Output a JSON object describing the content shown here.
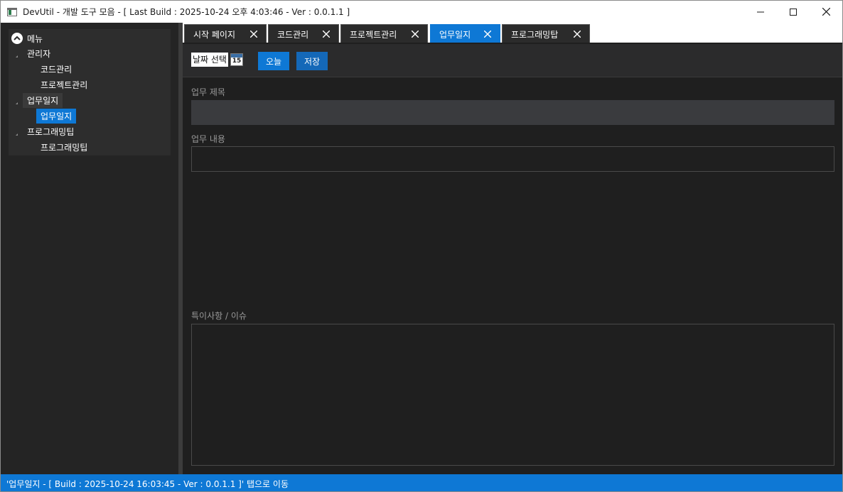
{
  "window": {
    "title": "DevUtil - 개발 도구 모음 - [ Last Build : 2025-10-24 오후 4:03:46 - Ver : 0.0.1.1 ]"
  },
  "sidebar": {
    "root_label": "메뉴",
    "groups": [
      {
        "label": "관리자",
        "children": [
          "코드관리",
          "프로젝트관리"
        ]
      },
      {
        "label": "업무일지",
        "children": [
          "업무일지"
        ]
      },
      {
        "label": "프로그래밍팁",
        "children": [
          "프로그래밍팁"
        ]
      }
    ]
  },
  "tabs": [
    {
      "label": "시작 페이지",
      "active": false
    },
    {
      "label": "코드관리",
      "active": false
    },
    {
      "label": "프로젝트관리",
      "active": false
    },
    {
      "label": "업무일지",
      "active": true
    },
    {
      "label": "프로그래밍탑",
      "active": false
    }
  ],
  "toolbar": {
    "date_placeholder": "날짜 선택",
    "calendar_day": "15",
    "today_label": "오늘",
    "save_label": "저장"
  },
  "form": {
    "title_label": "업무 제목",
    "title_value": "",
    "content_label": "업무 내용",
    "content_value": "",
    "issue_label": "특이사항 / 이슈",
    "issue_value": ""
  },
  "statusbar": {
    "text": "'업무일지 - [ Build : 2025-10-24 16:03:45 - Ver : 0.0.1.1 ]' 탭으로 이동"
  },
  "colors": {
    "accent": "#0e78d5",
    "background": "#1f1f1f",
    "sidebar": "#242424"
  }
}
